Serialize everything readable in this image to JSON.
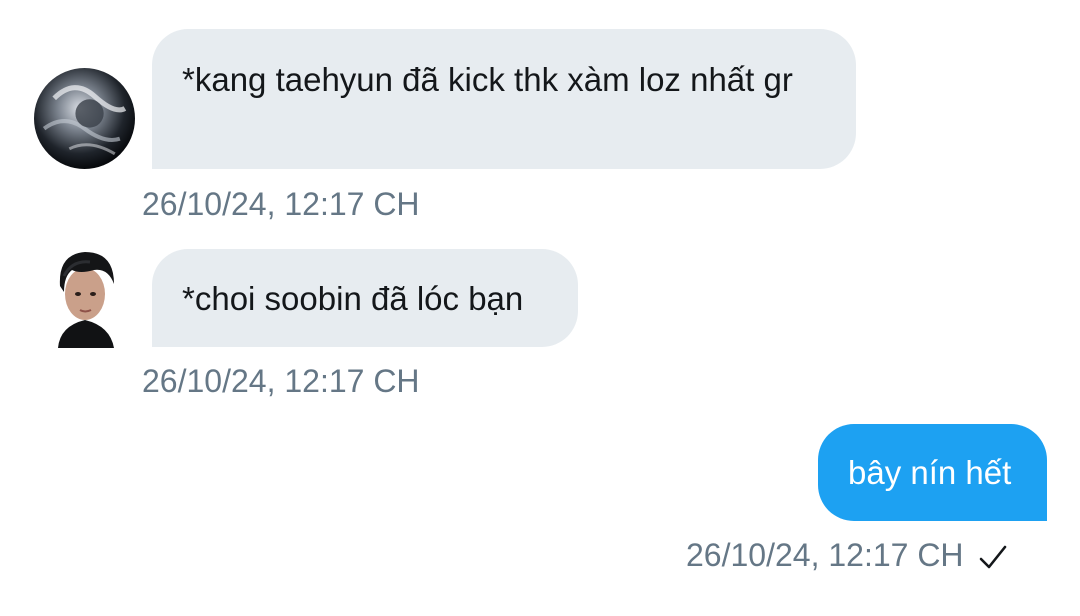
{
  "messages": [
    {
      "direction": "incoming",
      "avatar": "user-avatar-dark-smoke-icon",
      "text": "*kang taehyun đã kick thk xàm loz nhất gr",
      "timestamp": "26/10/24, 12:17 CH"
    },
    {
      "direction": "incoming",
      "avatar": "user-avatar-portrait-icon",
      "text": "*choi soobin đã lóc bạn",
      "timestamp": "26/10/24, 12:17 CH"
    },
    {
      "direction": "outgoing",
      "text": "bây nín hết",
      "timestamp": "26/10/24, 12:17 CH",
      "status_icon": "check-icon"
    }
  ],
  "colors": {
    "incoming_bubble": "#e7ecf0",
    "outgoing_bubble": "#1da1f2",
    "timestamp": "#657786",
    "text": "#14171a"
  }
}
